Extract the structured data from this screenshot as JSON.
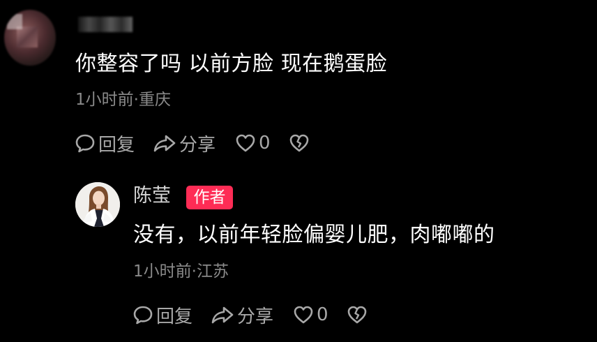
{
  "comment": {
    "text": "你整容了吗 以前方脸 现在鹅蛋脸",
    "meta": "1小时前·重庆",
    "actions": {
      "reply_label": "回复",
      "share_label": "分享",
      "like_count": "0"
    }
  },
  "reply": {
    "author": "陈莹",
    "badge": "作者",
    "text": "没有，以前年轻脸偏婴儿肥，肉嘟嘟的",
    "meta": "1小时前·江苏",
    "actions": {
      "reply_label": "回复",
      "share_label": "分享",
      "like_count": "0"
    }
  },
  "colors": {
    "background": "#000000",
    "primary_text": "#ffffff",
    "secondary_text": "#8a8a8a",
    "action_text": "#a8a8a8",
    "author_badge": "#fe2c55"
  },
  "icons": [
    "comment-bubble-icon",
    "share-arrow-icon",
    "heart-icon",
    "broken-heart-icon"
  ]
}
